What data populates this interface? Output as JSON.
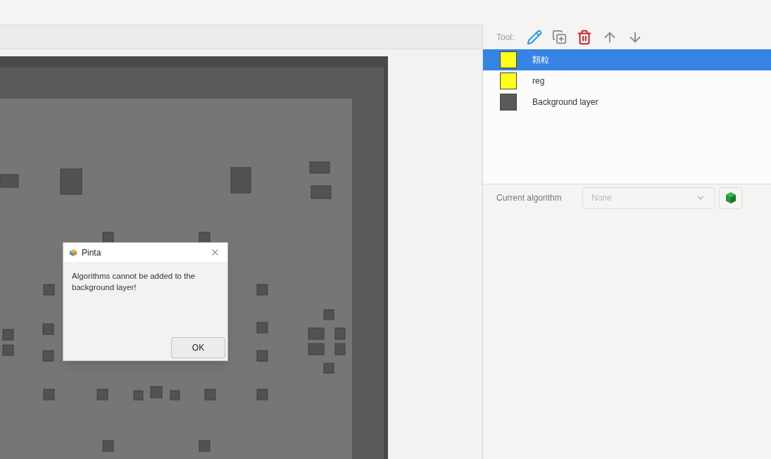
{
  "toolbar": {
    "label": "Tool:"
  },
  "layers": [
    {
      "name": "顆粒",
      "kind": "color",
      "color": "#ffff1a",
      "selected": true
    },
    {
      "name": "reg",
      "kind": "color",
      "color": "#ffff1a",
      "selected": false
    },
    {
      "name": "Background layer",
      "kind": "thumbnail",
      "selected": false
    }
  ],
  "algorithm": {
    "label": "Current algorithm",
    "placeholder": "None"
  },
  "dialog": {
    "title": "Pinta",
    "message": "Algorithms cannot be added to the background layer!",
    "button": "OK"
  }
}
